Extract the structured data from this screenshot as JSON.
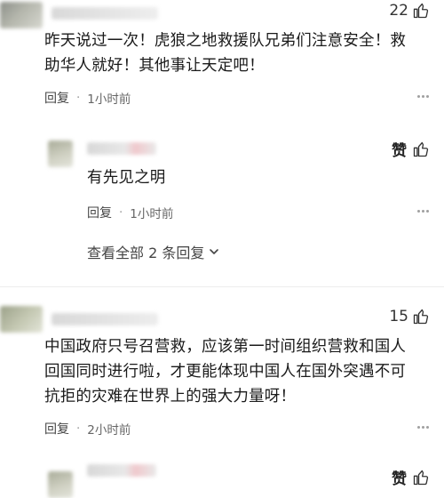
{
  "comments": [
    {
      "likes": "22",
      "text": "昨天说过一次！虎狼之地救援队兄弟们注意安全！救助华人就好！其他事让天定吧！",
      "reply_label": "回复",
      "time": "1小时前",
      "replies": [
        {
          "zan_label": "赞",
          "text": "有先见之明",
          "reply_label": "回复",
          "time": "1小时前"
        }
      ],
      "expand_label": "查看全部 2 条回复"
    },
    {
      "likes": "15",
      "text": "中国政府只号召营救，应该第一时间组织营救和国人回国同时进行啦，才更能体现中国人在国外突遇不可抗拒的灾难在世界上的强大力量呀！",
      "reply_label": "回复",
      "time": "2小时前",
      "replies": [
        {
          "zan_label": "赞"
        }
      ]
    }
  ],
  "icons": {
    "like": "thumb-up-icon",
    "expand": "chevron-down-icon",
    "more": "more-dots-icon"
  }
}
